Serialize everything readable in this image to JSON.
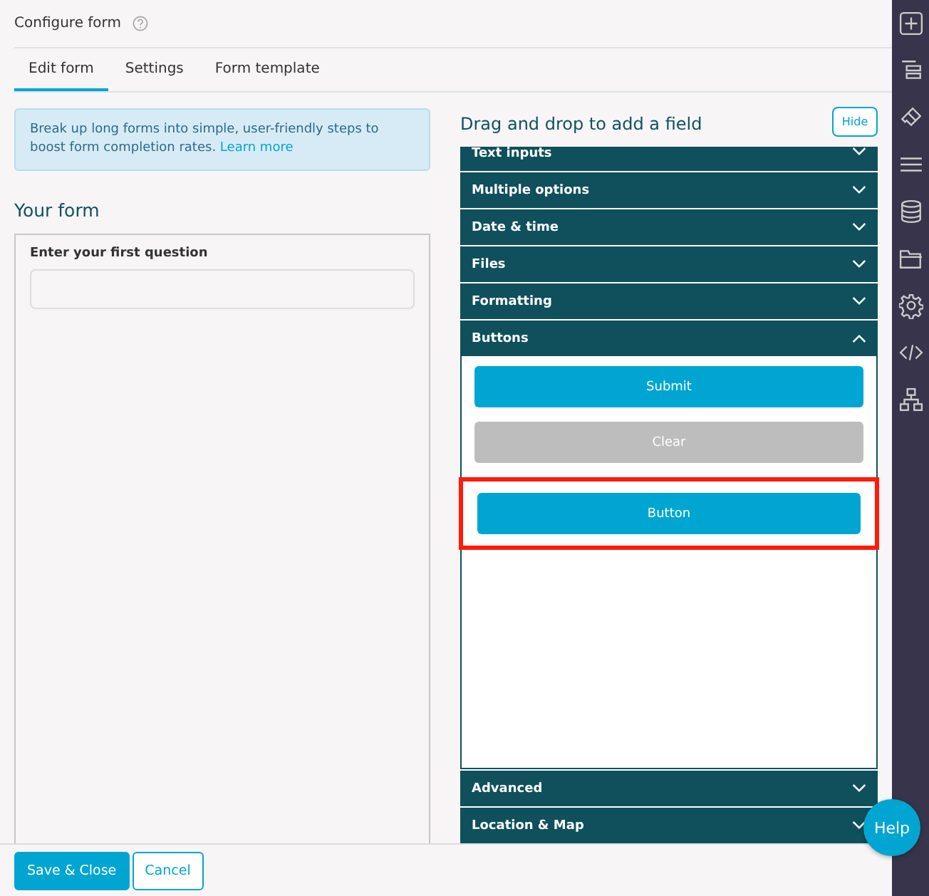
{
  "header": {
    "title": "Configure form"
  },
  "tabs": [
    {
      "label": "Edit form",
      "selected": true
    },
    {
      "label": "Settings",
      "selected": false
    },
    {
      "label": "Form template",
      "selected": false
    }
  ],
  "info": {
    "text": "Break up long forms into simple, user-friendly steps to boost form completion rates.",
    "link": "Learn more"
  },
  "form": {
    "heading": "Your form",
    "question": "Enter your first question"
  },
  "palette": {
    "heading": "Drag and drop to add a field",
    "hide_button": "Hide",
    "sections": [
      {
        "label": "Text inputs",
        "expanded": false
      },
      {
        "label": "Multiple options",
        "expanded": false
      },
      {
        "label": "Date & time",
        "expanded": false
      },
      {
        "label": "Files",
        "expanded": false
      },
      {
        "label": "Formatting",
        "expanded": false
      },
      {
        "label": "Buttons",
        "expanded": true,
        "items": [
          {
            "label": "Submit",
            "kind": "primary",
            "highlighted": false
          },
          {
            "label": "Clear",
            "kind": "secondary",
            "highlighted": false
          },
          {
            "label": "Button",
            "kind": "primary",
            "highlighted": true
          }
        ]
      },
      {
        "label": "Advanced",
        "expanded": false
      },
      {
        "label": "Location & Map",
        "expanded": false
      }
    ]
  },
  "footer": {
    "buttons": [
      {
        "label": "Save & Close",
        "kind": "primary"
      },
      {
        "label": "Cancel",
        "kind": "outline"
      }
    ]
  },
  "help": {
    "label": "Help"
  }
}
